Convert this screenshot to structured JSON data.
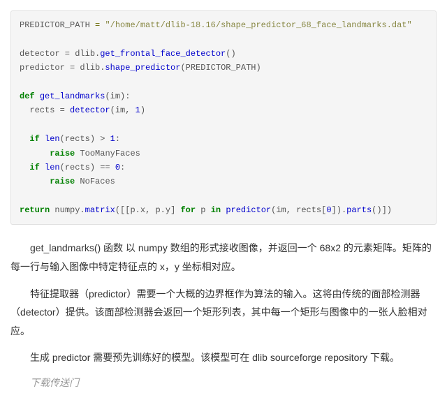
{
  "code": {
    "l1a": "PREDICTOR_PATH",
    "l1b": " = ",
    "l1c": "\"/home/matt/dlib-18.16/shape_predictor_68_face_landmarks.dat\"",
    "l3a": "detector = dlib.",
    "l3b": "get_frontal_face_detector",
    "l3c": "()",
    "l4a": "predictor = dlib.",
    "l4b": "shape_predictor",
    "l4c": "(PREDICTOR_PATH)",
    "l6a": "def",
    "l6b": " ",
    "l6c": "get_landmarks",
    "l6d": "(im):",
    "l7a": "  rects = ",
    "l7b": "detector",
    "l7c": "(im, ",
    "l7d": "1",
    "l7e": ")",
    "l9a": "  ",
    "l9b": "if",
    "l9c": " ",
    "l9d": "len",
    "l9e": "(rects) > ",
    "l9f": "1",
    "l9g": ":",
    "l10a": "      ",
    "l10b": "raise",
    "l10c": " TooManyFaces",
    "l11a": "  ",
    "l11b": "if",
    "l11c": " ",
    "l11d": "len",
    "l11e": "(rects) == ",
    "l11f": "0",
    "l11g": ":",
    "l12a": "      ",
    "l12b": "raise",
    "l12c": " NoFaces",
    "l14a": "return",
    "l14b": " numpy.",
    "l14c": "matrix",
    "l14d": "([[p.x, p.y] ",
    "l14e": "for",
    "l14f": " p ",
    "l14g": "in",
    "l14h": " ",
    "l14i": "predictor",
    "l14j": "(im, rects[",
    "l14k": "0",
    "l14l": "]).",
    "l14m": "parts",
    "l14n": "()])"
  },
  "paragraphs": {
    "p1": "get_landmarks() 函数 以 numpy 数组的形式接收图像，并返回一个 68x2 的元素矩阵。矩阵的每一行与输入图像中特定特征点的 x，y 坐标相对应。",
    "p2": "特征提取器（predictor）需要一个大概的边界框作为算法的输入。这将由传统的面部检测器（detector）提供。该面部检测器会返回一个矩形列表，其中每一个矩形与图像中的一张人脸相对应。",
    "p3": "生成 predictor 需要预先训练好的模型。该模型可在 dlib sourceforge repository 下载。",
    "note": "下载传送门"
  }
}
